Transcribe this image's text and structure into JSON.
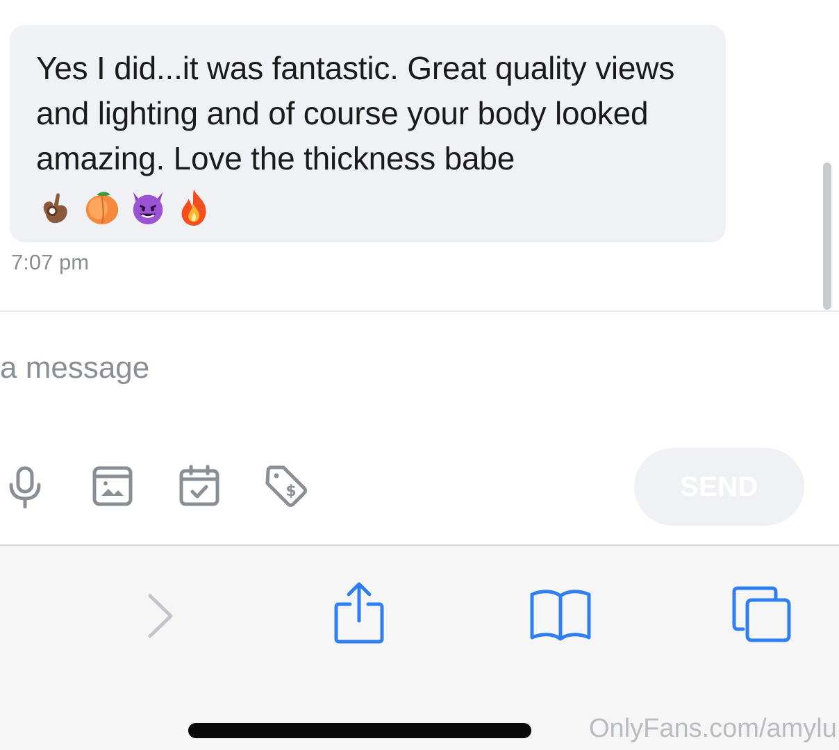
{
  "message": {
    "text": "Yes I did...it was fantastic. Great quality views and lighting and of course your body looked amazing. Love the thickness babe",
    "emojis": [
      "ok-hand-emoji",
      "peach-emoji",
      "smiling-devil-emoji",
      "fire-emoji"
    ],
    "time": "7:07 pm"
  },
  "composer": {
    "placeholder": "a message",
    "tools": [
      "microphone-icon",
      "image-icon",
      "calendar-icon",
      "price-tag-icon"
    ],
    "send_label": "SEND"
  },
  "browser_toolbar": {
    "icons": [
      "forward-chevron-icon",
      "share-icon",
      "bookmarks-icon",
      "tabs-icon"
    ]
  },
  "watermark": "OnlyFans.com/amylu",
  "colors": {
    "bubble": "#f0f1f4",
    "accent_blue": "#2f7ff0",
    "icon_gray": "#8a8e95"
  }
}
